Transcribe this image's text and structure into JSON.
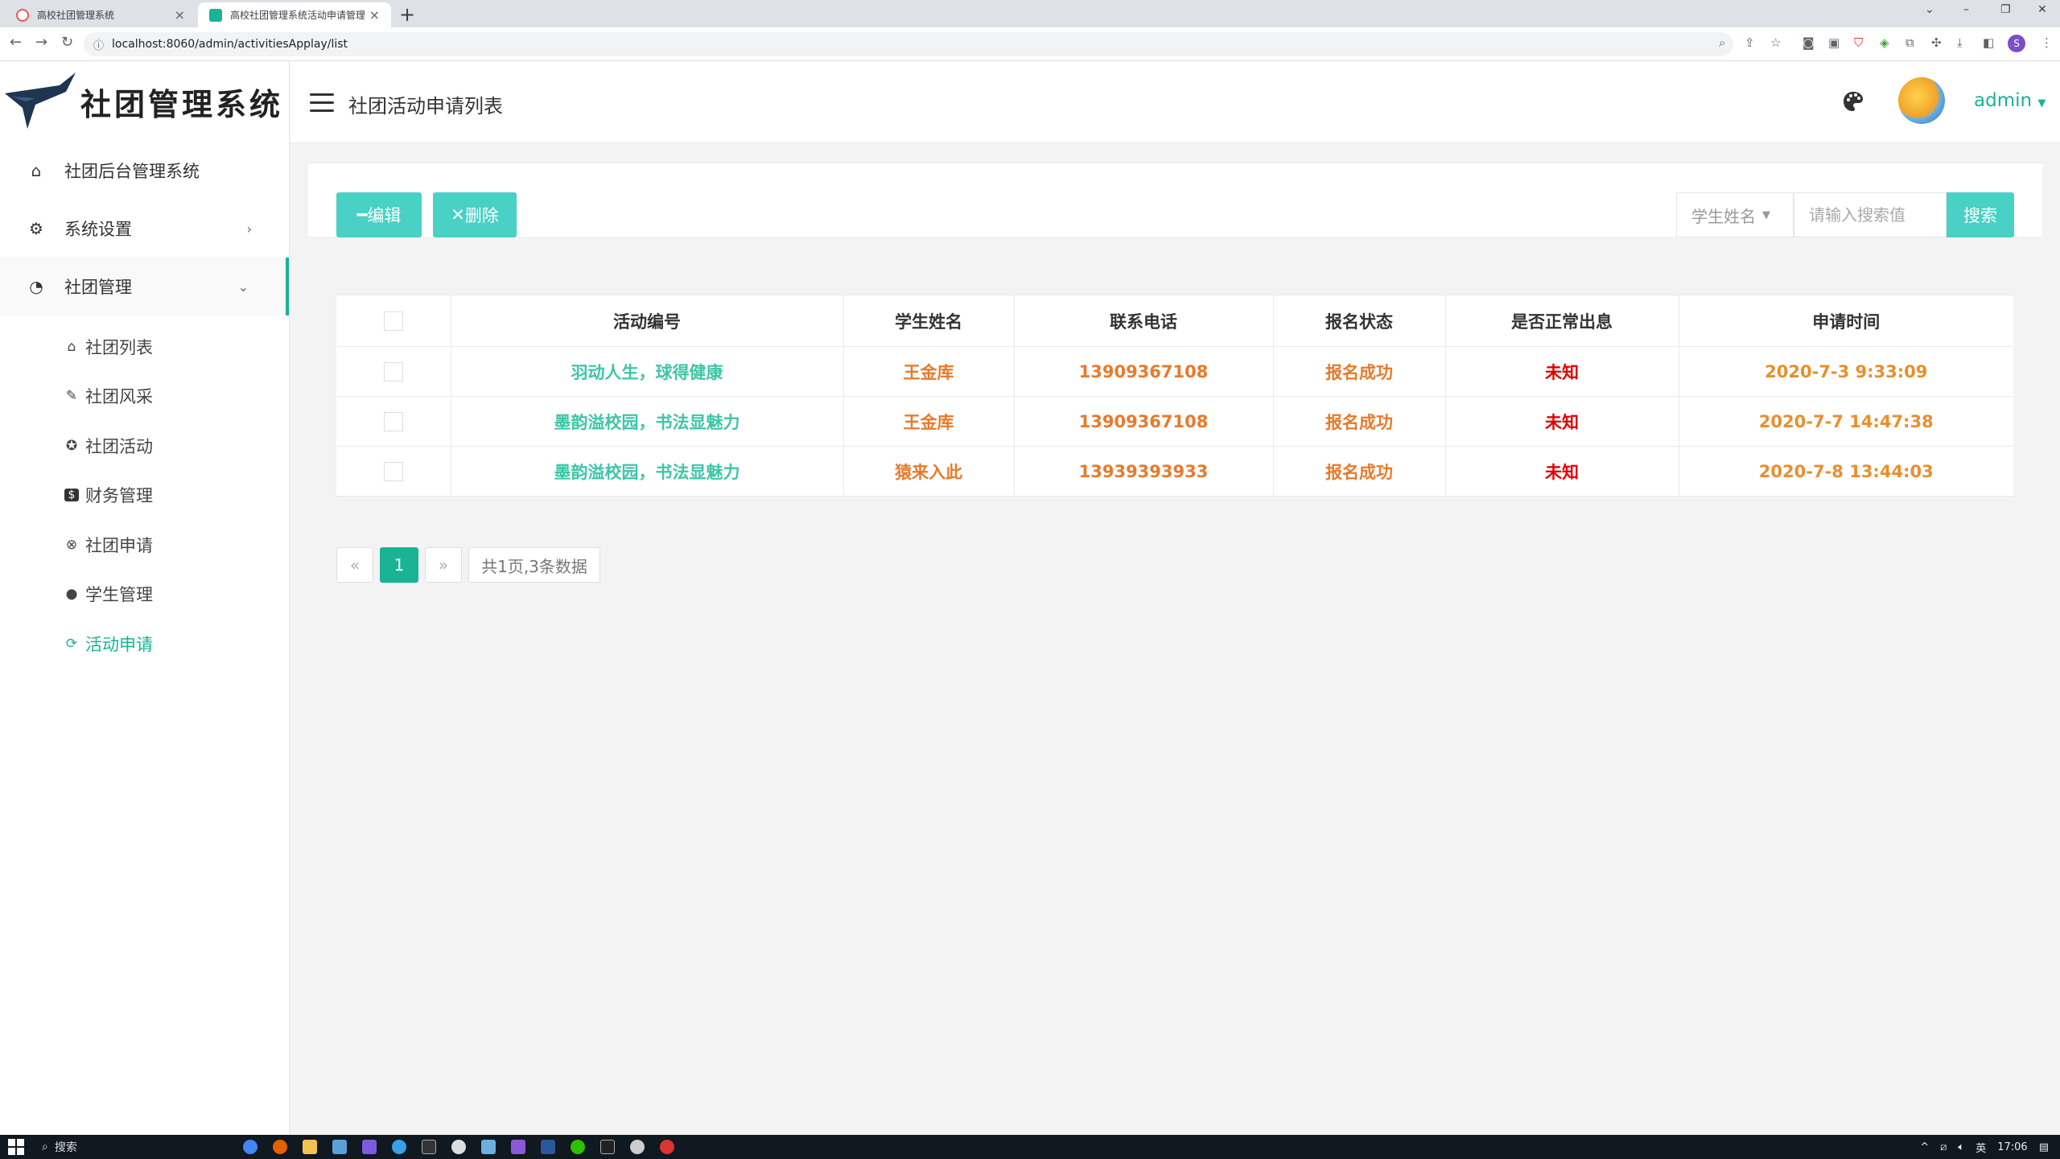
{
  "browser": {
    "tabs": [
      {
        "title": "高校社团管理系统",
        "active": false
      },
      {
        "title": "高校社团管理系统活动申请管理",
        "active": true
      }
    ],
    "url": "localhost:8060/admin/activitiesApplay/list"
  },
  "sidebar": {
    "logo_text": "社团管理系统",
    "menu": [
      {
        "label": "社团后台管理系统",
        "icon": "home-icon"
      },
      {
        "label": "系统设置",
        "icon": "gear-icon"
      },
      {
        "label": "社团管理",
        "icon": "dashboard-icon"
      }
    ],
    "submenu": [
      {
        "label": "社团列表",
        "icon": "home-icon"
      },
      {
        "label": "社团风采",
        "icon": "pen-icon"
      },
      {
        "label": "社团活动",
        "icon": "star-icon"
      },
      {
        "label": "财务管理",
        "icon": "dollar-icon"
      },
      {
        "label": "社团申请",
        "icon": "xbox-icon"
      },
      {
        "label": "学生管理",
        "icon": "user-icon"
      },
      {
        "label": "活动申请",
        "icon": "refresh-icon",
        "active": true
      }
    ]
  },
  "header": {
    "title": "社团活动申请列表",
    "user": "admin"
  },
  "toolbar": {
    "edit_label": "编辑",
    "delete_label": "删除",
    "filter_field": "学生姓名",
    "search_placeholder": "请输入搜索值",
    "search_label": "搜索"
  },
  "table": {
    "columns": [
      "活动编号",
      "学生姓名",
      "联系电话",
      "报名状态",
      "是否正常出息",
      "申请时间"
    ],
    "rows": [
      {
        "activity": "羽动人生，球得健康",
        "name": "王金库",
        "phone": "13909367108",
        "status": "报名成功",
        "normal": "未知",
        "time": "2020-7-3 9:33:09"
      },
      {
        "activity": "墨韵溢校园，书法显魅力",
        "name": "王金库",
        "phone": "13909367108",
        "status": "报名成功",
        "normal": "未知",
        "time": "2020-7-7 14:47:38"
      },
      {
        "activity": "墨韵溢校园，书法显魅力",
        "name": "猿来入此",
        "phone": "13939393933",
        "status": "报名成功",
        "normal": "未知",
        "time": "2020-7-8 13:44:03"
      }
    ]
  },
  "pager": {
    "prev": "«",
    "current": "1",
    "next": "»",
    "info": "共1页,3条数据"
  },
  "taskbar": {
    "search_label": "搜索",
    "ime": "英",
    "clock": "17:06"
  },
  "colors": {
    "accent": "#1ab394",
    "button": "#48d1c4",
    "orange": "#e87a2b",
    "red": "#e00000"
  }
}
